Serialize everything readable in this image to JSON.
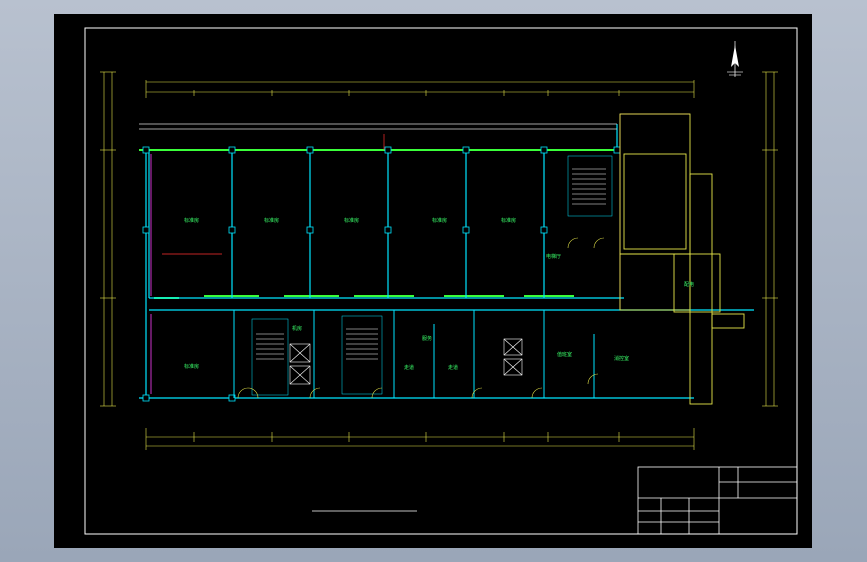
{
  "app": {
    "view": "CAD floor plan drawing viewport"
  },
  "colors": {
    "background": "#000000",
    "frame": "#ffffff",
    "wall": "#00e5ff",
    "window": "#3aff3a",
    "dimension": "#e6e64a",
    "stair": "#ffffff",
    "accent_red": "#ff3030",
    "accent_magenta": "#ff40ff"
  },
  "icons": [
    "north-arrow-icon"
  ],
  "rooms_top": [
    "标准房",
    "标准房",
    "标准房",
    "标准房",
    "标准房"
  ],
  "rooms_misc": {
    "left_lower": "标准房",
    "corridor_a": "走道",
    "corridor_b": "走道",
    "service": "服务",
    "mech": "机房",
    "right_room": "消控室",
    "right_small": "配电",
    "office": "值班室",
    "lift": "电梯厅"
  },
  "title_block": {
    "rows": 4
  }
}
